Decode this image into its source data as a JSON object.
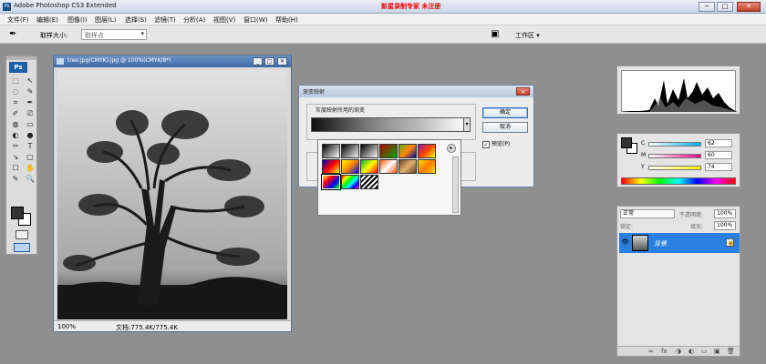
{
  "window": {
    "app_title": "Adobe Photoshop CS3 Extended",
    "notice": "新星录制专家  未注册",
    "controls": [
      "─",
      "□",
      "✕"
    ]
  },
  "menu": [
    "文件(F)",
    "编辑(E)",
    "图像(I)",
    "图层(L)",
    "选择(S)",
    "滤镜(T)",
    "分析(A)",
    "视图(V)",
    "窗口(W)",
    "帮助(H)"
  ],
  "options": {
    "tool_icon": "eyedropper-icon",
    "sample_label": "取样大小:",
    "sample_value": "取样点",
    "workspace_label": "工作区 ▾"
  },
  "toolbox": {
    "logo": "Ps",
    "tools": [
      "⬚",
      "↖",
      "◌",
      "✎",
      "⌗",
      "✒",
      "✐",
      "⎚",
      "◍",
      "▭",
      "◐",
      "●",
      "✑",
      "T",
      "↘",
      "▢",
      "☐",
      "✋",
      "✎",
      "🔍"
    ]
  },
  "document": {
    "title": "tree.jpg(CMYK).jpg @ 100%(CMYK/8*)",
    "zoom": "100%",
    "doc_size": "文档:775.4K/775.4K"
  },
  "dialog": {
    "title": "渐变映射",
    "group_label": "灰度映射所用的渐变",
    "ok": "确定",
    "cancel": "取消",
    "preview_label": "预览(P)",
    "preview_checked": "✓"
  },
  "gradient_picker": {
    "swatches": [
      "linear-gradient(135deg,#000,#fff)",
      "linear-gradient(135deg,#000,rgba(0,0,0,0))",
      "linear-gradient(135deg,#000,#fff)",
      "linear-gradient(135deg,#b00,#0a0)",
      "linear-gradient(135deg,#6a0,#f80,#00a)",
      "linear-gradient(135deg,#8a1aa8,#f40,#ff0)",
      "linear-gradient(135deg,#00c,#f00,#ff0)",
      "linear-gradient(135deg,#ff0,#f80,#00f)",
      "linear-gradient(135deg,#0a4,#ff0,#f00)",
      "linear-gradient(135deg,#f50,#fff,#f50)",
      "linear-gradient(135deg,#6b3f1e,#e0b070,#6b3f1e)",
      "linear-gradient(135deg,#fd0,#f70,#fd0)",
      "linear-gradient(135deg,#ff0,#f00,#00f,#0f0)",
      "linear-gradient(135deg,#f00,#ff0,#0f0,#0ff,#00f,#f0f)",
      "repeating-linear-gradient(135deg,#000 0 2px,#fff 2px 4px)"
    ]
  },
  "panels": {
    "color": {
      "rows": [
        {
          "ch": "C",
          "val": "62"
        },
        {
          "ch": "M",
          "val": "60"
        },
        {
          "ch": "Y",
          "val": "74"
        }
      ]
    },
    "layers": {
      "blend_mode": "正常",
      "opacity_label": "不透明度:",
      "opacity": "100%",
      "lock_label": "锁定:",
      "fill_label": "填充:",
      "fill": "100%",
      "layer_name": "背景",
      "footer_icons": [
        "∞",
        "fx",
        "◑",
        "◐",
        "▭",
        "▣",
        "🗑"
      ]
    }
  }
}
